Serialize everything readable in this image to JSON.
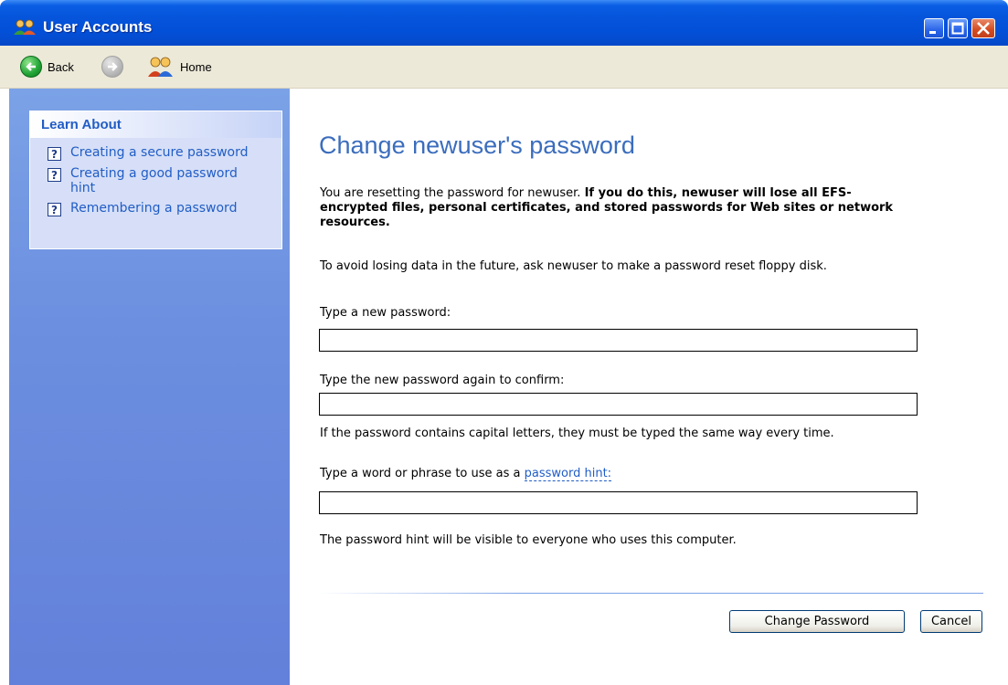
{
  "window": {
    "title": "User Accounts",
    "colors": {
      "titlebar": "#0554da",
      "sidebar": "#6c8fdf",
      "accent": "#3b6dbd",
      "link": "#215dc6"
    }
  },
  "toolbar": {
    "back_label": "Back",
    "home_label": "Home"
  },
  "sidebar": {
    "learn_about_title": "Learn About",
    "items": [
      {
        "label": "Creating a secure password",
        "icon": "help-icon"
      },
      {
        "label": "Creating a good password hint",
        "icon": "help-icon"
      },
      {
        "label": "Remembering a password",
        "icon": "help-icon"
      }
    ]
  },
  "main": {
    "heading": "Change newuser's password",
    "reset_notice_plain": "You are resetting the password for newuser.",
    "reset_notice_bold": "If you do this, newuser will lose all EFS-encrypted files, personal certificates, and stored passwords for Web sites or network resources.",
    "floppy_advice": "To avoid losing data in the future, ask newuser to make a password reset floppy disk.",
    "new_password_label": "Type a new password:",
    "new_password_value": "",
    "confirm_password_label": "Type the new password again to confirm:",
    "confirm_password_value": "",
    "capital_letters_note": "If the password contains capital letters, they must be typed the same way every time.",
    "hint_label_prefix": "Type a word or phrase to use as a",
    "hint_link": "password hint:",
    "hint_value": "",
    "hint_visibility_note": "The password hint will be visible to everyone who uses this computer.",
    "change_button_label": "Change Password",
    "cancel_button_label": "Cancel"
  }
}
